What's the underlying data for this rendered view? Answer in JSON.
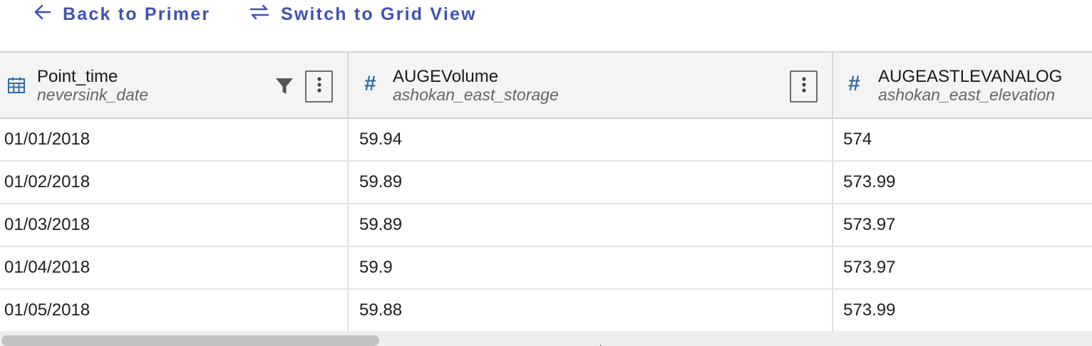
{
  "topbar": {
    "back_label": "Back to Primer",
    "switch_label": "Switch to Grid View"
  },
  "colors": {
    "link": "#3f51b5",
    "type_icon": "#2f6ea8"
  },
  "table": {
    "columns": [
      {
        "name": "Point_time",
        "subtitle": "neversink_date",
        "type_icon": "calendar-icon",
        "has_filter": true
      },
      {
        "name": "AUGEVolume",
        "subtitle": "ashokan_east_storage",
        "type_icon": "number-icon",
        "has_filter": false
      },
      {
        "name": "AUGEASTLEVANALOG",
        "subtitle": "ashokan_east_elevation",
        "type_icon": "number-icon",
        "has_filter": false
      }
    ],
    "rows": [
      [
        "01/01/2018",
        "59.94",
        "574"
      ],
      [
        "01/02/2018",
        "59.89",
        "573.99"
      ],
      [
        "01/03/2018",
        "59.89",
        "573.97"
      ],
      [
        "01/04/2018",
        "59.9",
        "573.97"
      ],
      [
        "01/05/2018",
        "59.88",
        "573.99"
      ]
    ]
  }
}
